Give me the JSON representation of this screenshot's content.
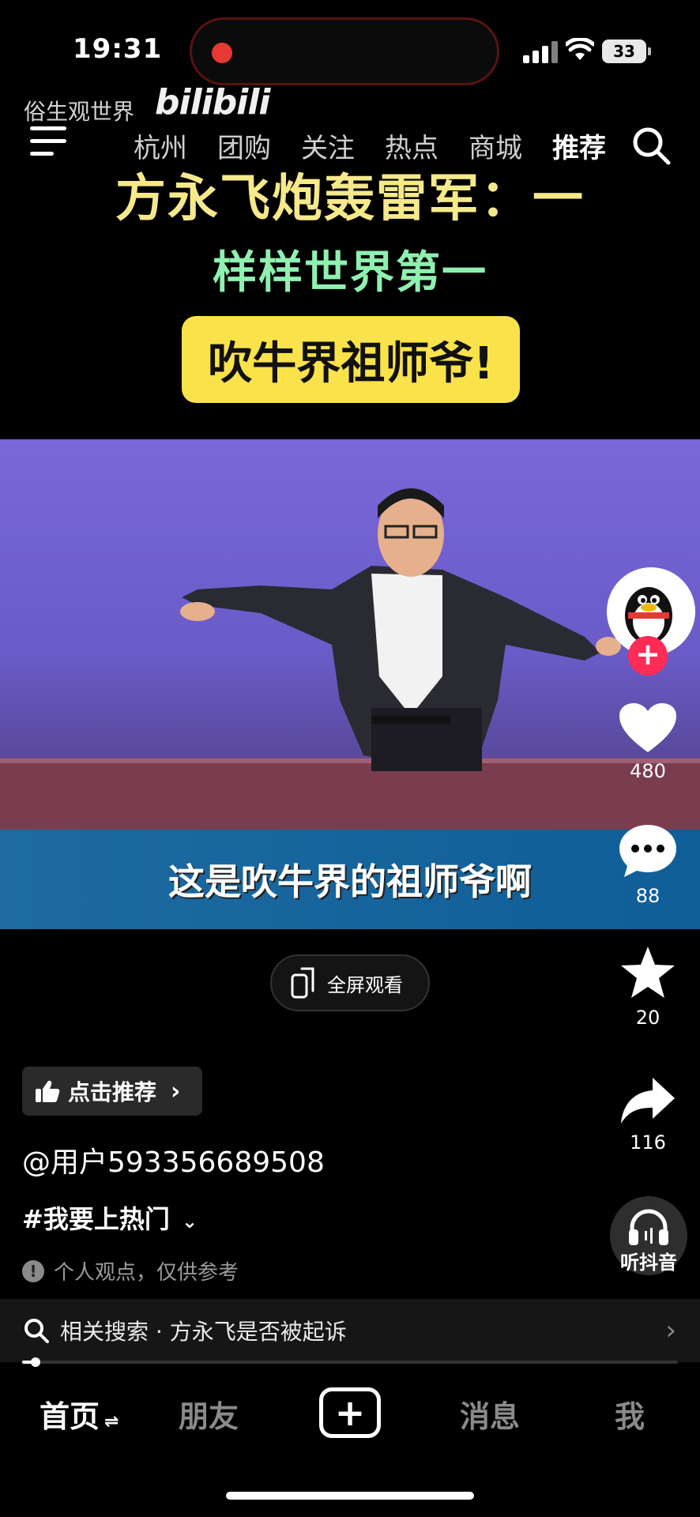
{
  "status_bar": {
    "time": "19:31",
    "battery": "33"
  },
  "watermark": {
    "channel": "俗生观世界",
    "platform": "bilibili"
  },
  "nav": {
    "tabs": [
      "杭州",
      "团购",
      "关注",
      "热点",
      "商城",
      "推荐"
    ],
    "active_tab": "推荐"
  },
  "video": {
    "title_line1": "方永飞炮轰雷军：一",
    "title_line2": "样样世界第一",
    "title_line3": "吹牛界祖师爷!",
    "subtitle": "这是吹牛界的祖师爷啊"
  },
  "fullscreen_button": {
    "label": "全屏观看"
  },
  "actions": {
    "likes": "480",
    "comments": "88",
    "favorites": "20",
    "shares": "116",
    "listen_label": "听抖音"
  },
  "info": {
    "recommend_label": "点击推荐",
    "username": "@用户593356689508",
    "hashtag": "#我要上热门",
    "notice": "个人观点，仅供参考"
  },
  "related_search": {
    "text": "相关搜索 · 方永飞是否被起诉"
  },
  "progress": {
    "fraction": 0.02
  },
  "tabbar": {
    "home": "首页",
    "friends": "朋友",
    "messages": "消息",
    "me": "我"
  },
  "colors": {
    "accent": "#fe2c55",
    "caption_yellow": "#fae34a",
    "subtitle_blue": "#1f6aa2"
  }
}
